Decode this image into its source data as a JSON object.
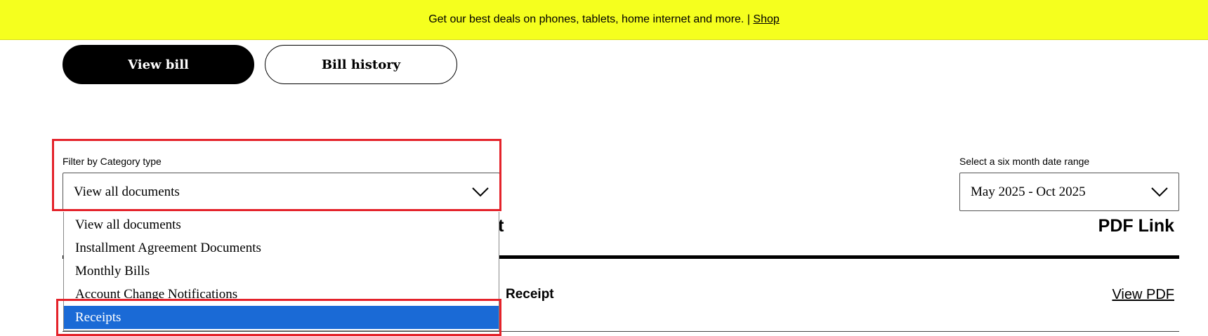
{
  "promo": {
    "text": "Get our best deals on phones, tablets, home internet and more. |",
    "link_label": "Shop"
  },
  "tabs": {
    "view_bill": "View bill",
    "bill_history": "Bill history"
  },
  "category_filter": {
    "label": "Filter by Category type",
    "value": "View all documents",
    "options": [
      "View all documents",
      "Installment Agreement Documents",
      "Monthly Bills",
      "Account Change Notifications",
      "Receipts"
    ],
    "highlighted_option": "Receipts"
  },
  "date_filter": {
    "label": "Select a six month date range",
    "value": "May 2025 - Oct 2025"
  },
  "table": {
    "header_document_fragment": "ent",
    "header_pdf": "PDF Link",
    "rows": [
      {
        "title_fragment": "Receipt",
        "link": "View PDF"
      }
    ]
  },
  "colors": {
    "promo_bg": "#f5ff1e",
    "selected_option_bg": "#1a6ad6",
    "annotation": "#e4222a"
  }
}
